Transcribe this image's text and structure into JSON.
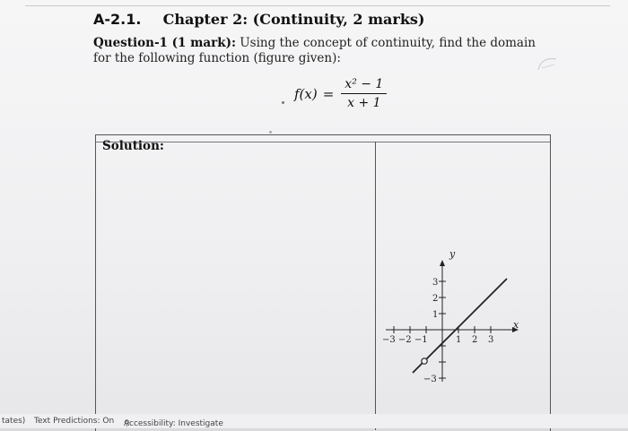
{
  "heading": {
    "number": "A-2.1.",
    "chapter": "Chapter 2: (Continuity, 2 marks)"
  },
  "question": {
    "label": "Question-1 (1 mark):",
    "text": "Using the concept of continuity, find the domain for the following function (figure given):"
  },
  "formula": {
    "lhs": "f(x)",
    "equals": "=",
    "numerator": "x² − 1",
    "denominator": "x + 1"
  },
  "solution": {
    "label": "Solution:"
  },
  "graph": {
    "x_axis_label": "x",
    "y_axis_label": "y",
    "x_ticks_negative": "−3 −2 −1",
    "x_ticks_positive": [
      "1",
      "2",
      "3"
    ],
    "y_ticks_positive": [
      "3",
      "2",
      "1"
    ],
    "y_tick_negative": "−3"
  },
  "statusbar": {
    "left_fragment": "tates)",
    "text_predictions": "Text Predictions: On",
    "accessibility": "Accessibility: Investigate"
  },
  "colors": {
    "page": "#f0f0f2",
    "ink": "#111111",
    "table_border": "#555555"
  },
  "icons": [
    "accessibility-icon"
  ]
}
